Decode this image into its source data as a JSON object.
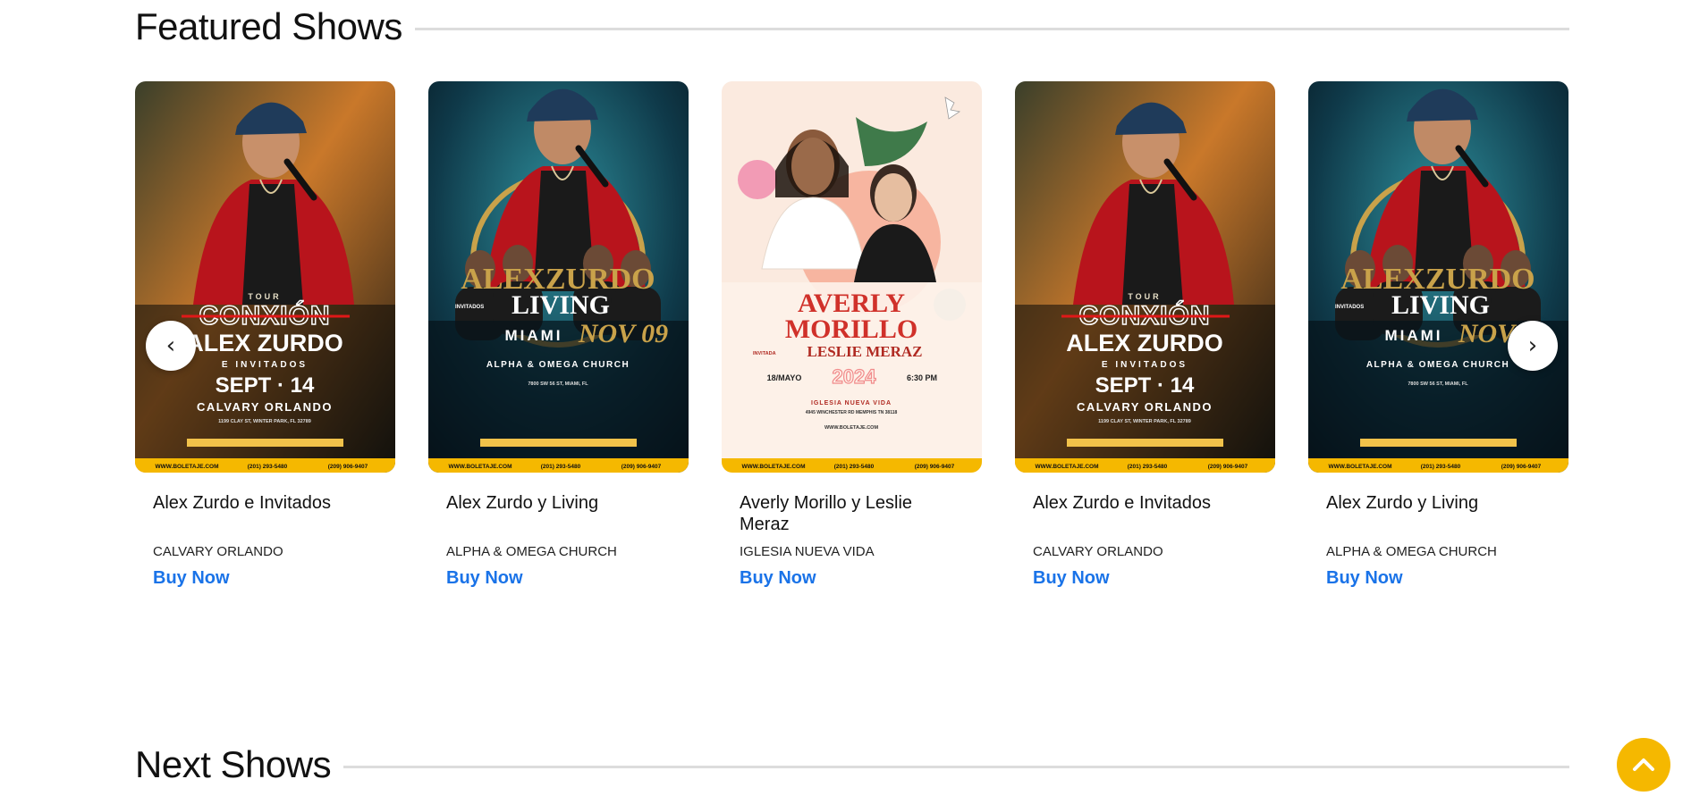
{
  "featured": {
    "title": "Featured Shows"
  },
  "next": {
    "title": "Next Shows"
  },
  "carousel": {
    "prev_label": "‹",
    "next_label": "›",
    "cards": [
      {
        "title": "Alex Zurdo e Invitados",
        "venue": "CALVARY ORLANDO",
        "buy_label": "Buy Now",
        "poster": {
          "theme": "gold",
          "tour": "TOUR",
          "headline": "CONXIÓN",
          "artist": "ALEX ZURDO",
          "guests": "E INVITADOS",
          "date": "SEPT · 14",
          "venue": "CALVARY ORLANDO",
          "address": "1199 CLAY ST, WINTER PARK, FL 32789",
          "footer_web": "WWW.BOLETAJE.COM",
          "footer_phone1": "(201) 293-5480",
          "footer_phone2": "(209) 906-9407"
        }
      },
      {
        "title": "Alex Zurdo y Living",
        "venue": "ALPHA & OMEGA CHURCH",
        "buy_label": "Buy Now",
        "poster": {
          "theme": "teal",
          "artist": "ALEXZURDO",
          "guests": "INVITADOS",
          "band": "LIVING",
          "city": "MIAMI",
          "date": "NOV 09",
          "venue": "ALPHA & OMEGA CHURCH",
          "address": "7800 SW 56 ST, MIAMI, FL",
          "footer_web": "WWW.BOLETAJE.COM",
          "footer_phone1": "(201) 293-5480",
          "footer_phone2": "(209) 906-9407"
        }
      },
      {
        "title": "Averly Morillo y Leslie Meraz",
        "venue": "IGLESIA NUEVA VIDA",
        "buy_label": "Buy Now",
        "poster": {
          "theme": "light",
          "artist1": "AVERLY",
          "artist2": "MORILLO",
          "guest_tag": "INVITADA",
          "guest": "LESLIE MERAZ",
          "day": "18/MAYO",
          "year": "2024",
          "time": "6:30 PM",
          "venue": "IGLESIA NUEVA VIDA",
          "address": "4945 WINCHESTER RD MEMPHIS TN 38118",
          "site": "WWW.BOLETAJE.COM",
          "footer_web": "WWW.BOLETAJE.COM",
          "footer_phone1": "(201) 293-5480",
          "footer_phone2": "(209) 906-9407"
        }
      },
      {
        "title": "Alex Zurdo e Invitados",
        "venue": "CALVARY ORLANDO",
        "buy_label": "Buy Now",
        "poster": {
          "theme": "gold",
          "tour": "TOUR",
          "headline": "CONXIÓN",
          "artist": "ALEX ZURDO",
          "guests": "E INVITADOS",
          "date": "SEPT · 14",
          "venue": "CALVARY ORLANDO",
          "address": "1199 CLAY ST, WINTER PARK, FL 32789",
          "footer_web": "WWW.BOLETAJE.COM",
          "footer_phone1": "(201) 293-5480",
          "footer_phone2": "(209) 906-9407"
        }
      },
      {
        "title": "Alex Zurdo y Living",
        "venue": "ALPHA & OMEGA CHURCH",
        "buy_label": "Buy Now",
        "poster": {
          "theme": "teal",
          "artist": "ALEXZURDO",
          "guests": "INVITADOS",
          "band": "LIVING",
          "city": "MIAMI",
          "date": "NOV 09",
          "venue": "ALPHA & OMEGA CHURCH",
          "address": "7800 SW 56 ST, MIAMI, FL",
          "footer_web": "WWW.BOLETAJE.COM",
          "footer_phone1": "(201) 293-5480",
          "footer_phone2": "(209) 906-9407"
        }
      }
    ]
  },
  "colors": {
    "link": "#1a73e8",
    "accent": "#f5b800",
    "rule": "#dcdcdc"
  },
  "icons": {
    "prev": "chevron-left-icon",
    "next": "chevron-right-icon",
    "back_to_top": "chevron-up-icon"
  }
}
